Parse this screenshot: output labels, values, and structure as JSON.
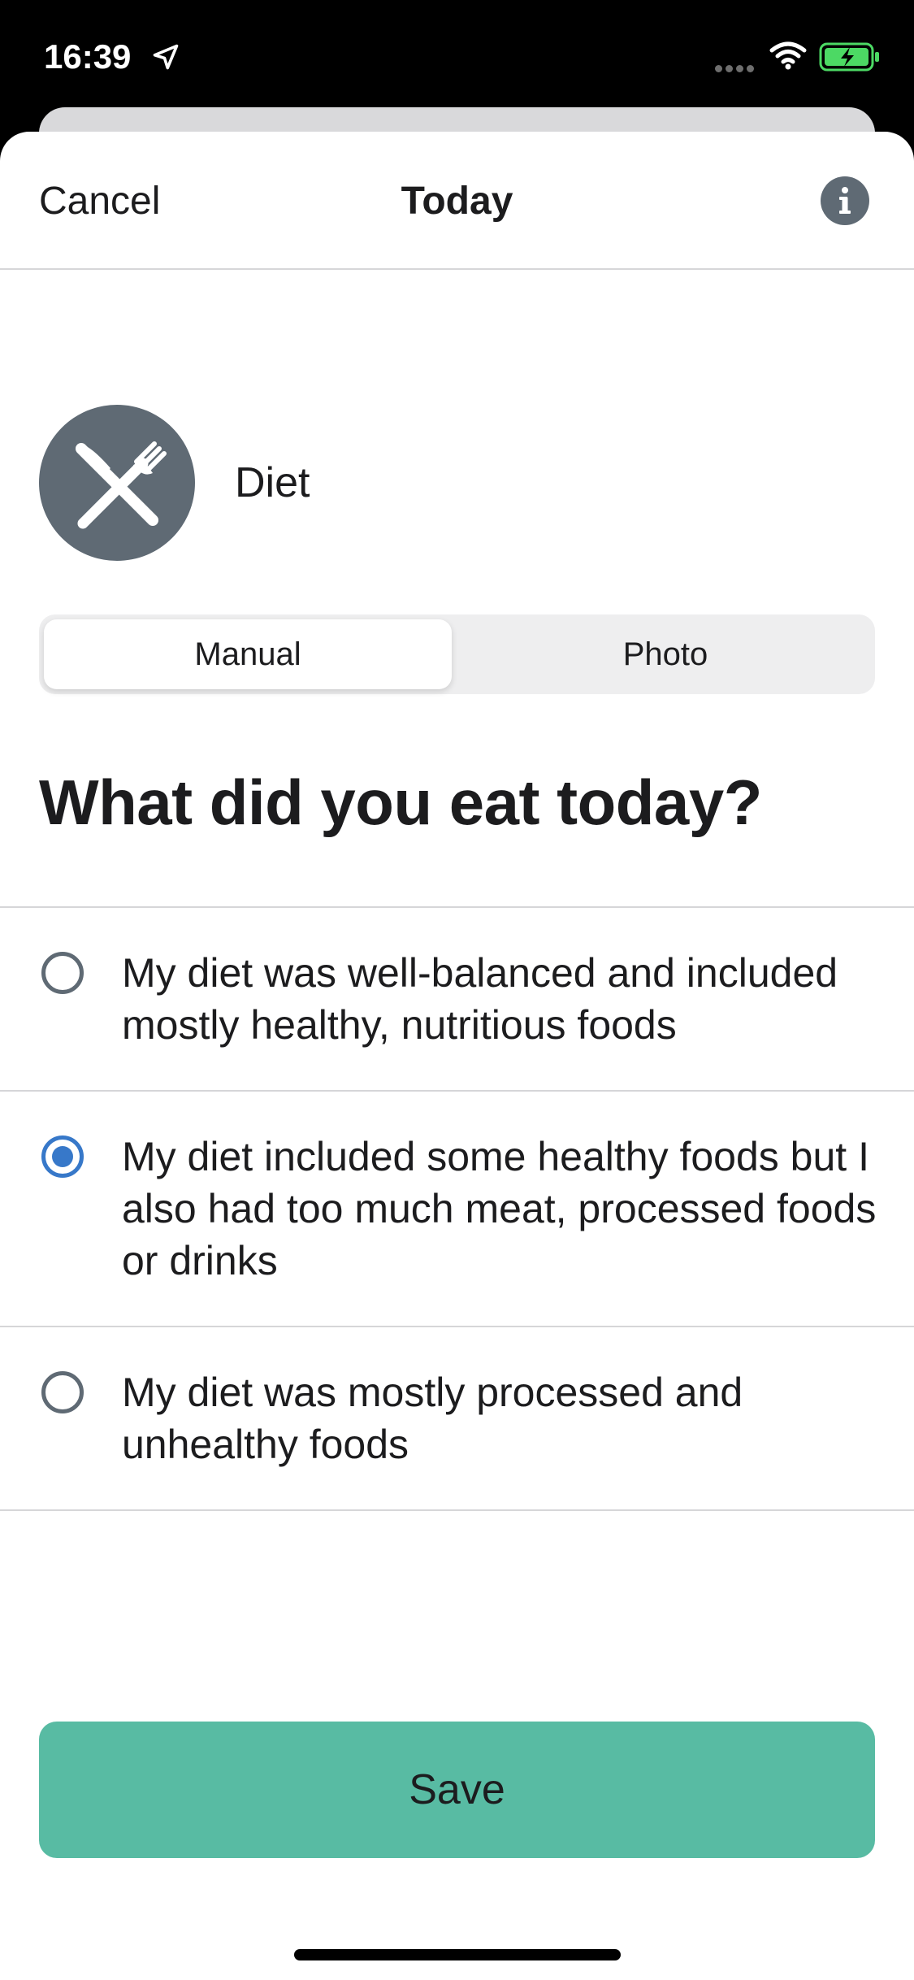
{
  "status_bar": {
    "time": "16:39",
    "icons": [
      "location-arrow-icon",
      "signal-icon",
      "wifi-icon",
      "battery-charging-icon"
    ]
  },
  "nav": {
    "cancel_label": "Cancel",
    "title": "Today",
    "info_icon": "info-icon"
  },
  "category": {
    "icon": "fork-knife-icon",
    "label": "Diet"
  },
  "segment": {
    "options": [
      "Manual",
      "Photo"
    ],
    "selected": "Manual"
  },
  "question": "What did you eat today?",
  "options": [
    {
      "text": "My diet was well-balanced and included mostly healthy, nutritious foods",
      "selected": false
    },
    {
      "text": "My diet included some healthy foods but I also had too much meat, processed foods or drinks",
      "selected": true
    },
    {
      "text": "My diet was mostly processed and unhealthy foods",
      "selected": false
    }
  ],
  "save_label": "Save",
  "colors": {
    "accent_button": "#58bba3",
    "radio_selected": "#3778c9",
    "icon_gray": "#5f6a74"
  }
}
